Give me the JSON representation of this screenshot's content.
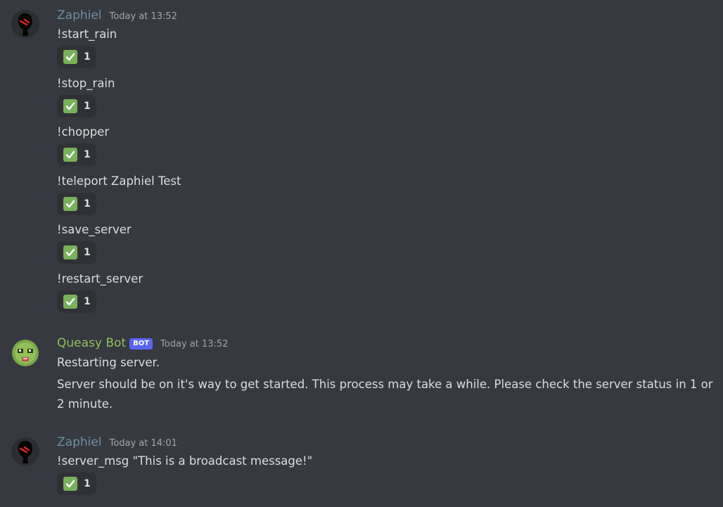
{
  "groups": [
    {
      "author": "Zaphiel",
      "timestamp": "Today at 13:52",
      "messages": [
        {
          "text": "!start_rain",
          "reaction": {
            "emoji": "white-check-mark",
            "count": "1"
          }
        },
        {
          "text": "!stop_rain",
          "reaction": {
            "emoji": "white-check-mark",
            "count": "1"
          }
        },
        {
          "text": "!chopper",
          "reaction": {
            "emoji": "white-check-mark",
            "count": "1"
          }
        },
        {
          "text": "!teleport Zaphiel Test",
          "reaction": {
            "emoji": "white-check-mark",
            "count": "1"
          }
        },
        {
          "text": "!save_server",
          "reaction": {
            "emoji": "white-check-mark",
            "count": "1"
          }
        },
        {
          "text": "!restart_server",
          "reaction": {
            "emoji": "white-check-mark",
            "count": "1"
          }
        }
      ]
    },
    {
      "author": "Queasy Bot",
      "bot_tag": "BOT",
      "timestamp": "Today at 13:52",
      "messages": [
        {
          "text": "Restarting server."
        },
        {
          "text": "Server should be on it's way to get started. This process may take a while. Please check the server status in 1 or 2 minute."
        }
      ]
    },
    {
      "author": "Zaphiel",
      "timestamp": "Today at 14:01",
      "messages": [
        {
          "text": "!server_msg \"This is a broadcast message!\"",
          "reaction": {
            "emoji": "white-check-mark",
            "count": "1"
          }
        }
      ]
    }
  ],
  "colors": {
    "background": "#36393f",
    "zaphiel_name": "#6f8ea3",
    "bot_name": "#91c05b",
    "bot_tag": "#5865f2",
    "reaction_bg": "#2f3136",
    "check_green": "#78b159"
  }
}
